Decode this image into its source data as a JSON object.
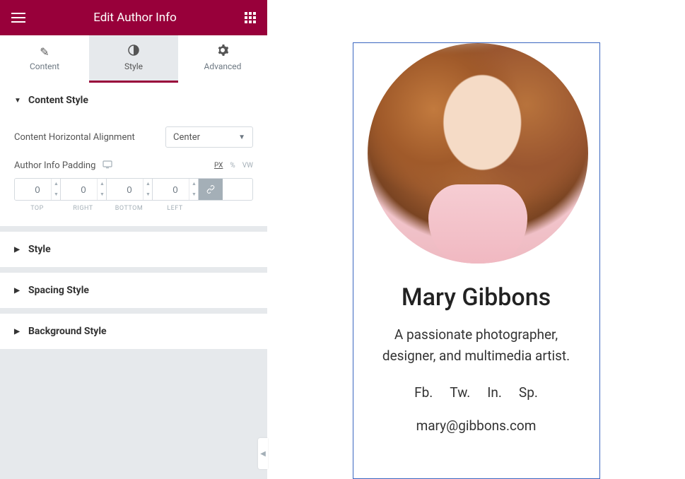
{
  "header": {
    "title": "Edit Author Info"
  },
  "tabs": {
    "content": "Content",
    "style": "Style",
    "advanced": "Advanced"
  },
  "sections": {
    "contentStyle": {
      "title": "Content Style",
      "alignment": {
        "label": "Content Horizontal Alignment",
        "value": "Center"
      },
      "padding": {
        "label": "Author Info Padding",
        "units": {
          "px": "PX",
          "pct": "%",
          "vw": "VW"
        },
        "values": {
          "top": "0",
          "right": "0",
          "bottom": "0",
          "left": "0"
        },
        "sideLabels": {
          "top": "TOP",
          "right": "RIGHT",
          "bottom": "BOTTOM",
          "left": "LEFT"
        }
      }
    },
    "style": {
      "title": "Style"
    },
    "spacingStyle": {
      "title": "Spacing Style"
    },
    "backgroundStyle": {
      "title": "Background Style"
    }
  },
  "author": {
    "name": "Mary Gibbons",
    "bio": "A passionate photographer, designer, and multimedia artist.",
    "social": {
      "fb": "Fb.",
      "tw": "Tw.",
      "in": "In.",
      "sp": "Sp."
    },
    "email": "mary@gibbons.com"
  }
}
